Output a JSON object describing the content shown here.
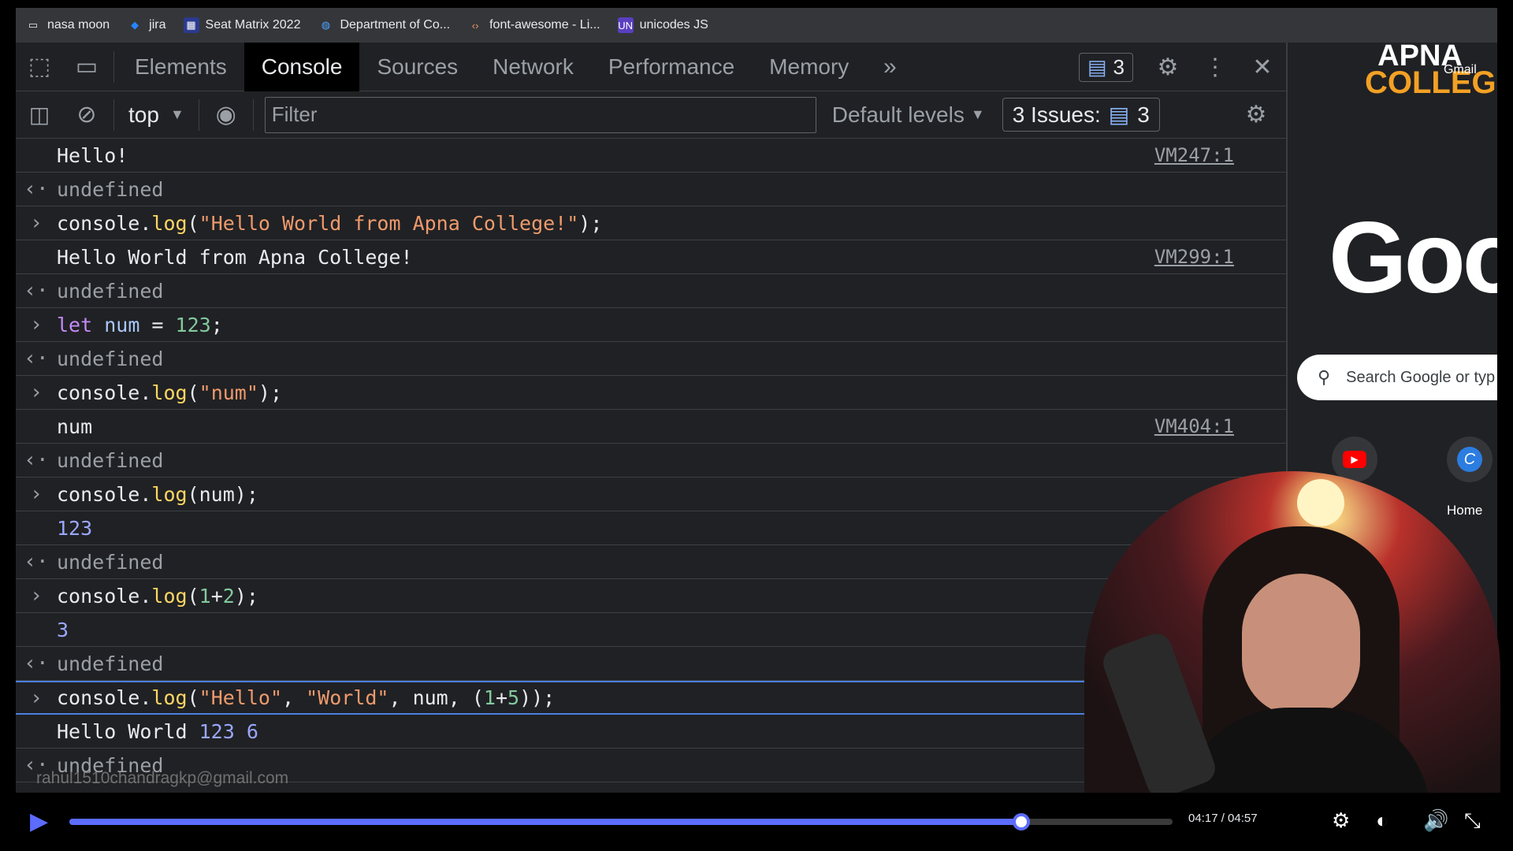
{
  "bookmarks": [
    {
      "label": "nasa moon",
      "icon": "folder-icon"
    },
    {
      "label": "jira",
      "icon": "jira-icon"
    },
    {
      "label": "Seat Matrix 2022",
      "icon": "seat-matrix-icon"
    },
    {
      "label": "Department of Co...",
      "icon": "department-icon"
    },
    {
      "label": "font-awesome - Li...",
      "icon": "code-icon"
    },
    {
      "label": "unicodes JS",
      "icon": "un-icon"
    }
  ],
  "devtools": {
    "tabs": [
      "Elements",
      "Console",
      "Sources",
      "Network",
      "Performance",
      "Memory"
    ],
    "active_tab": "Console",
    "message_count": "3",
    "toolbar": {
      "context": "top",
      "filter_placeholder": "Filter",
      "levels": "Default levels",
      "issues_label": "3 Issues:",
      "issues_count": "3"
    },
    "console_rows": [
      {
        "kind": "output",
        "parts": [
          {
            "t": "Hello!"
          }
        ],
        "src": "VM247:1"
      },
      {
        "kind": "result",
        "parts": [
          {
            "t": "undefined"
          }
        ]
      },
      {
        "kind": "input",
        "parts": [
          {
            "t": "console."
          },
          {
            "t": "log",
            "c": "f"
          },
          {
            "t": "("
          },
          {
            "t": "\"Hello World from Apna College!\"",
            "c": "s"
          },
          {
            "t": ");"
          }
        ]
      },
      {
        "kind": "output",
        "parts": [
          {
            "t": "Hello World from Apna College!"
          }
        ],
        "src": "VM299:1"
      },
      {
        "kind": "result",
        "parts": [
          {
            "t": "undefined"
          }
        ]
      },
      {
        "kind": "input",
        "parts": [
          {
            "t": "let",
            "c": "k"
          },
          {
            "t": " "
          },
          {
            "t": "num",
            "c": "n"
          },
          {
            "t": " = "
          },
          {
            "t": "123",
            "c": "g"
          },
          {
            "t": ";"
          }
        ]
      },
      {
        "kind": "result",
        "parts": [
          {
            "t": "undefined"
          }
        ]
      },
      {
        "kind": "input",
        "parts": [
          {
            "t": "console."
          },
          {
            "t": "log",
            "c": "f"
          },
          {
            "t": "("
          },
          {
            "t": "\"num\"",
            "c": "s"
          },
          {
            "t": ");"
          }
        ]
      },
      {
        "kind": "output",
        "parts": [
          {
            "t": "num"
          }
        ],
        "src": "VM404:1"
      },
      {
        "kind": "result",
        "parts": [
          {
            "t": "undefined"
          }
        ]
      },
      {
        "kind": "input",
        "parts": [
          {
            "t": "console."
          },
          {
            "t": "log",
            "c": "f"
          },
          {
            "t": "(num);"
          }
        ]
      },
      {
        "kind": "output",
        "parts": [
          {
            "t": "123",
            "c": "num"
          }
        ]
      },
      {
        "kind": "result",
        "parts": [
          {
            "t": "undefined"
          }
        ]
      },
      {
        "kind": "input",
        "parts": [
          {
            "t": "console."
          },
          {
            "t": "log",
            "c": "f"
          },
          {
            "t": "("
          },
          {
            "t": "1",
            "c": "g"
          },
          {
            "t": "+"
          },
          {
            "t": "2",
            "c": "g"
          },
          {
            "t": ");"
          }
        ]
      },
      {
        "kind": "output",
        "parts": [
          {
            "t": "3",
            "c": "num"
          }
        ]
      },
      {
        "kind": "result",
        "parts": [
          {
            "t": "undefined"
          }
        ]
      },
      {
        "kind": "input",
        "hl": true,
        "parts": [
          {
            "t": "console."
          },
          {
            "t": "log",
            "c": "f"
          },
          {
            "t": "("
          },
          {
            "t": "\"Hello\"",
            "c": "s"
          },
          {
            "t": ", "
          },
          {
            "t": "\"World\"",
            "c": "s"
          },
          {
            "t": ", num, ("
          },
          {
            "t": "1",
            "c": "g"
          },
          {
            "t": "+"
          },
          {
            "t": "5",
            "c": "g"
          },
          {
            "t": "));"
          }
        ]
      },
      {
        "kind": "output",
        "parts": [
          {
            "t": "Hello World "
          },
          {
            "t": "123 6",
            "c": "num"
          }
        ]
      },
      {
        "kind": "result",
        "parts": [
          {
            "t": "undefined"
          }
        ]
      }
    ]
  },
  "newtab": {
    "logo_line1": "APNA",
    "logo_line2": "COLLEGE",
    "gmail": "Gmail",
    "google_text": "Goo",
    "search_placeholder": "Search Google or typ",
    "shortcut_home": "Home"
  },
  "watermark": "rahul1510chandragkp@gmail.com",
  "video": {
    "time": "04:17 / 04:57",
    "progress": 0.863,
    "accent": "#5b6cff"
  }
}
